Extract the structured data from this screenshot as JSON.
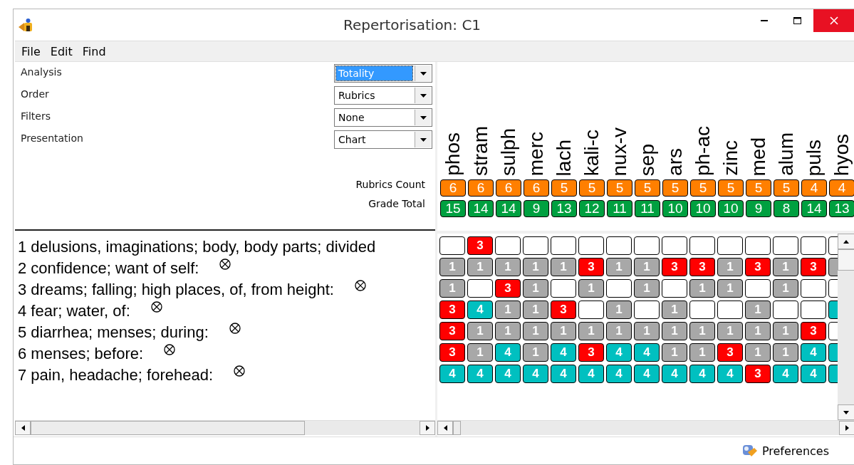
{
  "window": {
    "title": "Repertorisation: C1"
  },
  "menu": [
    "File",
    "Edit",
    "Find"
  ],
  "settings": [
    {
      "label": "Analysis",
      "value": "Totality",
      "focused": true
    },
    {
      "label": "Order",
      "value": "Rubrics",
      "focused": false
    },
    {
      "label": "Filters",
      "value": "None",
      "focused": false
    },
    {
      "label": "Presentation",
      "value": "Chart",
      "focused": false
    }
  ],
  "summary_labels": [
    "Rubrics Count",
    "Grade Total"
  ],
  "remedies": [
    {
      "name": "phos",
      "rubrics_count": "6",
      "grade_total": "15"
    },
    {
      "name": "stram",
      "rubrics_count": "6",
      "grade_total": "14"
    },
    {
      "name": "sulph",
      "rubrics_count": "6",
      "grade_total": "14"
    },
    {
      "name": "merc",
      "rubrics_count": "6",
      "grade_total": "9"
    },
    {
      "name": "lach",
      "rubrics_count": "5",
      "grade_total": "13"
    },
    {
      "name": "kali-c",
      "rubrics_count": "5",
      "grade_total": "12"
    },
    {
      "name": "nux-v",
      "rubrics_count": "5",
      "grade_total": "11"
    },
    {
      "name": "sep",
      "rubrics_count": "5",
      "grade_total": "11"
    },
    {
      "name": "ars",
      "rubrics_count": "5",
      "grade_total": "10"
    },
    {
      "name": "ph-ac",
      "rubrics_count": "5",
      "grade_total": "10"
    },
    {
      "name": "zinc",
      "rubrics_count": "5",
      "grade_total": "10"
    },
    {
      "name": "med",
      "rubrics_count": "5",
      "grade_total": "9"
    },
    {
      "name": "alum",
      "rubrics_count": "5",
      "grade_total": "8"
    },
    {
      "name": "puls",
      "rubrics_count": "4",
      "grade_total": "14"
    },
    {
      "name": "hyos",
      "rubrics_count": "4",
      "grade_total": "13"
    }
  ],
  "rubrics": [
    {
      "text": "1 delusions, imaginations; body, body parts; divided",
      "marked": false
    },
    {
      "text": "2 confidence; want of self:",
      "marked": true
    },
    {
      "text": "3 dreams; falling; high places, of, from height:",
      "marked": true
    },
    {
      "text": "4 fear; water, of:",
      "marked": true
    },
    {
      "text": "5 diarrhea; menses; during:",
      "marked": true
    },
    {
      "text": "6 menses; before:",
      "marked": true
    },
    {
      "text": "7 pain, headache; forehead:",
      "marked": true
    }
  ],
  "grid": [
    [
      {
        "kind": "empty"
      },
      {
        "kind": "red",
        "value": "3"
      },
      {
        "kind": "empty"
      },
      {
        "kind": "empty"
      },
      {
        "kind": "empty"
      },
      {
        "kind": "empty"
      },
      {
        "kind": "empty"
      },
      {
        "kind": "empty"
      },
      {
        "kind": "empty"
      },
      {
        "kind": "empty"
      },
      {
        "kind": "empty"
      },
      {
        "kind": "empty"
      },
      {
        "kind": "empty"
      },
      {
        "kind": "empty"
      },
      {
        "kind": "empty"
      }
    ],
    [
      {
        "kind": "grey",
        "value": "1"
      },
      {
        "kind": "grey",
        "value": "1"
      },
      {
        "kind": "grey",
        "value": "1"
      },
      {
        "kind": "grey",
        "value": "1"
      },
      {
        "kind": "grey",
        "value": "1"
      },
      {
        "kind": "red",
        "value": "3"
      },
      {
        "kind": "grey",
        "value": "1"
      },
      {
        "kind": "grey",
        "value": "1"
      },
      {
        "kind": "red",
        "value": "3"
      },
      {
        "kind": "red",
        "value": "3"
      },
      {
        "kind": "grey",
        "value": "1"
      },
      {
        "kind": "red",
        "value": "3"
      },
      {
        "kind": "grey",
        "value": "1"
      },
      {
        "kind": "red",
        "value": "3"
      },
      {
        "kind": "grey"
      }
    ],
    [
      {
        "kind": "grey",
        "value": "1"
      },
      {
        "kind": "empty"
      },
      {
        "kind": "red",
        "value": "3"
      },
      {
        "kind": "grey",
        "value": "1"
      },
      {
        "kind": "empty"
      },
      {
        "kind": "grey",
        "value": "1"
      },
      {
        "kind": "empty"
      },
      {
        "kind": "grey",
        "value": "1"
      },
      {
        "kind": "empty"
      },
      {
        "kind": "grey",
        "value": "1"
      },
      {
        "kind": "grey",
        "value": "1"
      },
      {
        "kind": "empty"
      },
      {
        "kind": "grey",
        "value": "1"
      },
      {
        "kind": "empty"
      },
      {
        "kind": "empty"
      }
    ],
    [
      {
        "kind": "red",
        "value": "3"
      },
      {
        "kind": "cyan",
        "value": "4"
      },
      {
        "kind": "grey",
        "value": "1"
      },
      {
        "kind": "grey",
        "value": "1"
      },
      {
        "kind": "red",
        "value": "3"
      },
      {
        "kind": "empty"
      },
      {
        "kind": "grey",
        "value": "1"
      },
      {
        "kind": "empty"
      },
      {
        "kind": "grey",
        "value": "1"
      },
      {
        "kind": "empty"
      },
      {
        "kind": "empty"
      },
      {
        "kind": "grey",
        "value": "1"
      },
      {
        "kind": "empty"
      },
      {
        "kind": "empty"
      },
      {
        "kind": "cyan"
      }
    ],
    [
      {
        "kind": "red",
        "value": "3"
      },
      {
        "kind": "grey",
        "value": "1"
      },
      {
        "kind": "grey",
        "value": "1"
      },
      {
        "kind": "grey",
        "value": "1"
      },
      {
        "kind": "grey",
        "value": "1"
      },
      {
        "kind": "grey",
        "value": "1"
      },
      {
        "kind": "grey",
        "value": "1"
      },
      {
        "kind": "grey",
        "value": "1"
      },
      {
        "kind": "grey",
        "value": "1"
      },
      {
        "kind": "grey",
        "value": "1"
      },
      {
        "kind": "grey",
        "value": "1"
      },
      {
        "kind": "grey",
        "value": "1"
      },
      {
        "kind": "grey",
        "value": "1"
      },
      {
        "kind": "red",
        "value": "3"
      },
      {
        "kind": "empty"
      }
    ],
    [
      {
        "kind": "red",
        "value": "3"
      },
      {
        "kind": "grey",
        "value": "1"
      },
      {
        "kind": "cyan",
        "value": "4"
      },
      {
        "kind": "grey",
        "value": "1"
      },
      {
        "kind": "cyan",
        "value": "4"
      },
      {
        "kind": "red",
        "value": "3"
      },
      {
        "kind": "cyan",
        "value": "4"
      },
      {
        "kind": "cyan",
        "value": "4"
      },
      {
        "kind": "grey",
        "value": "1"
      },
      {
        "kind": "grey",
        "value": "1"
      },
      {
        "kind": "red",
        "value": "3"
      },
      {
        "kind": "grey",
        "value": "1"
      },
      {
        "kind": "grey",
        "value": "1"
      },
      {
        "kind": "cyan",
        "value": "4"
      },
      {
        "kind": "cyan"
      }
    ],
    [
      {
        "kind": "cyan",
        "value": "4"
      },
      {
        "kind": "cyan",
        "value": "4"
      },
      {
        "kind": "cyan",
        "value": "4"
      },
      {
        "kind": "cyan",
        "value": "4"
      },
      {
        "kind": "cyan",
        "value": "4"
      },
      {
        "kind": "cyan",
        "value": "4"
      },
      {
        "kind": "cyan",
        "value": "4"
      },
      {
        "kind": "cyan",
        "value": "4"
      },
      {
        "kind": "cyan",
        "value": "4"
      },
      {
        "kind": "cyan",
        "value": "4"
      },
      {
        "kind": "cyan",
        "value": "4"
      },
      {
        "kind": "red",
        "value": "3"
      },
      {
        "kind": "cyan",
        "value": "4"
      },
      {
        "kind": "cyan",
        "value": "4"
      },
      {
        "kind": "cyan"
      }
    ]
  ],
  "status_bar": {
    "button": "Preferences"
  }
}
